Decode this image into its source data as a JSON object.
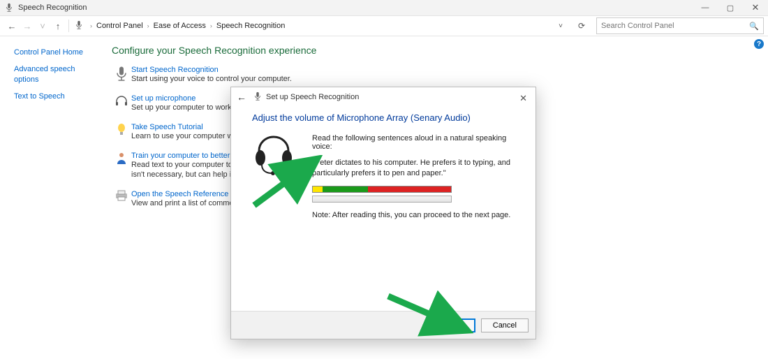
{
  "window": {
    "title": "Speech Recognition",
    "controls": {
      "min": "—",
      "max": "▢",
      "close": "✕"
    }
  },
  "toolbar": {
    "back": "←",
    "fwd": "→",
    "up": "↑",
    "dropdown": "˅",
    "refresh": "⟳"
  },
  "breadcrumbs": [
    "Control Panel",
    "Ease of Access",
    "Speech Recognition"
  ],
  "search": {
    "placeholder": "Search Control Panel"
  },
  "sidebar": {
    "links": [
      "Control Panel Home",
      "Advanced speech options",
      "Text to Speech"
    ]
  },
  "main": {
    "heading": "Configure your Speech Recognition experience",
    "items": [
      {
        "link": "Start Speech Recognition",
        "desc": "Start using your voice to control your computer."
      },
      {
        "link": "Set up microphone",
        "desc": "Set up your computer to work proper"
      },
      {
        "link": "Take Speech Tutorial",
        "desc": "Learn to use your computer with spee"
      },
      {
        "link": "Train your computer to better underst",
        "desc": "Read text to your computer to impro\nisn't necessary, but can help improve"
      },
      {
        "link": "Open the Speech Reference Card",
        "desc": "View and print a list of common com"
      }
    ]
  },
  "wizard": {
    "title": "Set up Speech Recognition",
    "heading": "Adjust the volume of Microphone Array (Senary Audio)",
    "instruction": "Read the following sentences aloud in a natural speaking voice:",
    "quote": "\"Peter dictates to his computer. He prefers it to typing, and particularly prefers it to pen and paper.\"",
    "note": "Note: After reading this, you can proceed to the next page.",
    "buttons": {
      "next": "Next",
      "cancel": "Cancel"
    },
    "meter": {
      "yellow_pct": 7,
      "green_pct": 33,
      "red_pct": 60
    }
  },
  "help_icon": "?"
}
